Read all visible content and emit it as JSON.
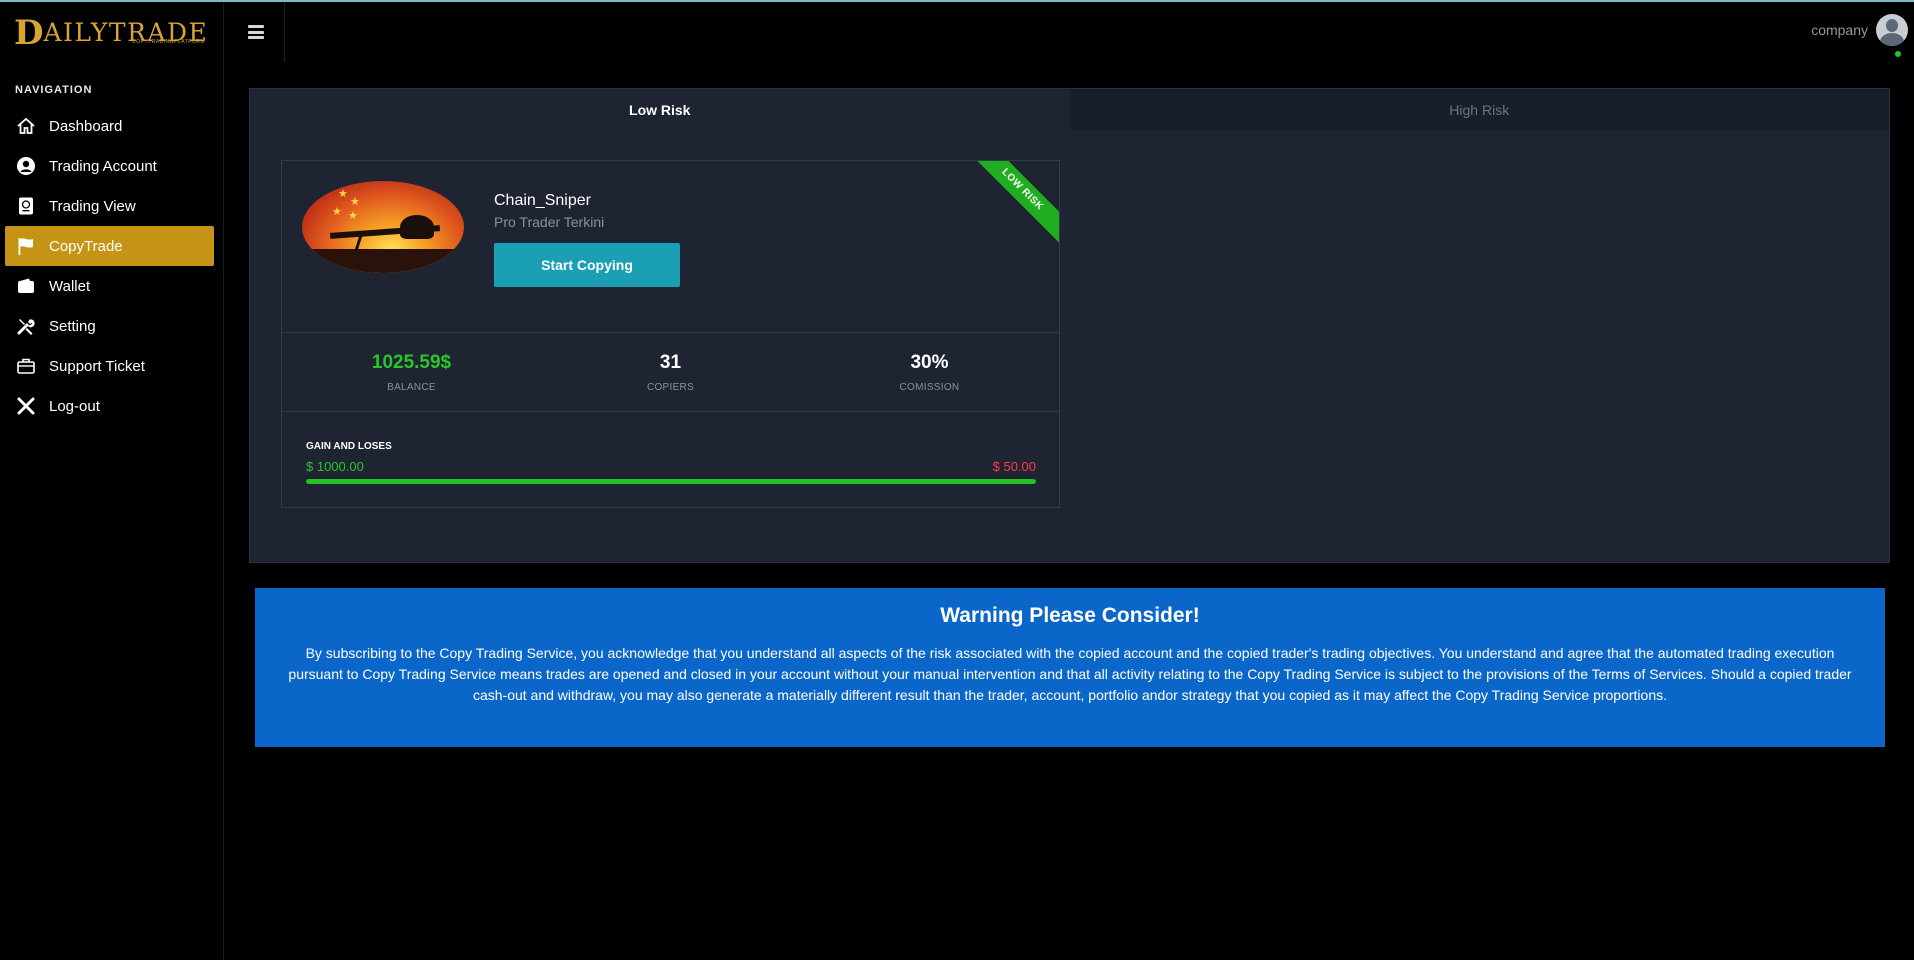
{
  "app": {
    "logo_mark": "D",
    "logo_text": "AILYTRADE",
    "logo_sub": "COPYTRADINGPLATFORM"
  },
  "sidebar": {
    "heading": "NAVIGATION",
    "items": [
      {
        "label": "Dashboard",
        "icon": "home-icon",
        "active": false
      },
      {
        "label": "Trading Account",
        "icon": "user-circle-icon",
        "active": false
      },
      {
        "label": "Trading View",
        "icon": "passport-icon",
        "active": false
      },
      {
        "label": "CopyTrade",
        "icon": "flag-icon",
        "active": true
      },
      {
        "label": "Wallet",
        "icon": "wallet-icon",
        "active": false
      },
      {
        "label": "Setting",
        "icon": "tools-icon",
        "active": false
      },
      {
        "label": "Support Ticket",
        "icon": "briefcase-icon",
        "active": false
      },
      {
        "label": "Log-out",
        "icon": "close-icon",
        "active": false
      }
    ]
  },
  "header": {
    "user_name": "company"
  },
  "tabs": [
    {
      "label": "Low Risk",
      "active": true
    },
    {
      "label": "High Risk",
      "active": false
    }
  ],
  "trader": {
    "name": "Chain_Sniper",
    "subtitle": "Pro Trader Terkini",
    "button": "Start Copying",
    "ribbon": "LOW RISK",
    "stats": [
      {
        "value": "1025.59$",
        "label": "BALANCE"
      },
      {
        "value": "31",
        "label": "COPIERS"
      },
      {
        "value": "30%",
        "label": "COMISSION"
      }
    ],
    "gain_loss": {
      "title": "GAIN AND LOSES",
      "gain": "$ 1000.00",
      "loss": "$ 50.00",
      "progress_percent": 100
    }
  },
  "warning": {
    "title": "Warning Please Consider!",
    "text": "By subscribing to the Copy Trading Service, you acknowledge that you understand all aspects of the risk associated with the copied account and the copied trader's trading objectives. You understand and agree that the automated trading execution pursuant to Copy Trading Service means trades are opened and closed in your account without your manual intervention and that all activity relating to the Copy Trading Service is subject to the provisions of the Terms of Services. Should a copied trader cash-out and withdraw, you may also generate a materially different result than the trader, account, portfolio andor strategy that you copied as it may affect the Copy Trading Service proportions."
  },
  "colors": {
    "accent": "#c69414",
    "brand": "#d6a532",
    "button": "#1a9fb4",
    "gain": "#29c529",
    "loss": "#ff3b4f",
    "warning_bg": "#0b66c9"
  }
}
